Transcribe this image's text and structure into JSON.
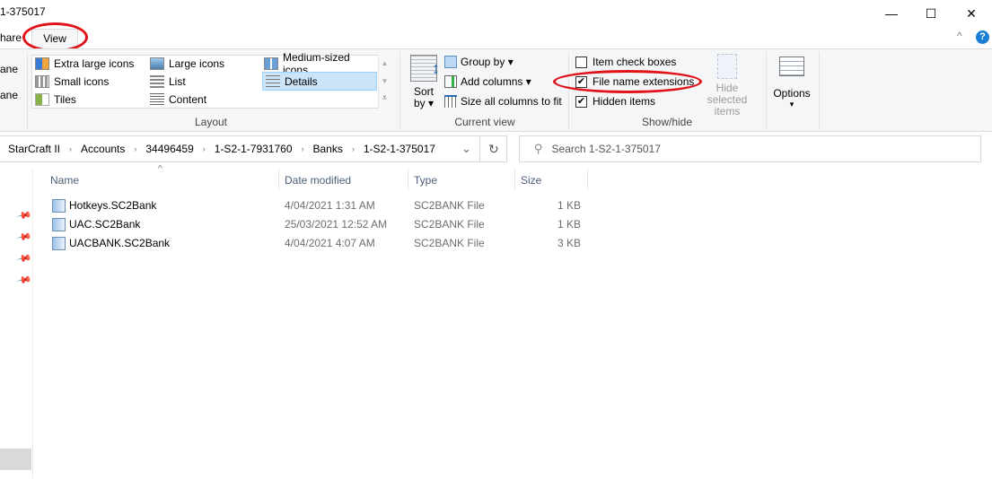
{
  "window": {
    "title": "1-375017",
    "controls": {
      "minimize": "—",
      "maximize": "☐",
      "close": "✕"
    }
  },
  "tabs": [
    {
      "label": "hare",
      "active": false
    },
    {
      "label": "View",
      "active": true
    }
  ],
  "ribbon": {
    "collapse_label": "^",
    "help_label": "?",
    "panes_partial": [
      "ane",
      "ane"
    ],
    "layout": {
      "group_label": "Layout",
      "items": [
        {
          "label": "Extra large icons",
          "icon": "extra-large-icons-icon"
        },
        {
          "label": "Large icons",
          "icon": "large-icons-icon"
        },
        {
          "label": "Medium-sized icons",
          "icon": "medium-icons-icon"
        },
        {
          "label": "Small icons",
          "icon": "small-icons-icon"
        },
        {
          "label": "List",
          "icon": "list-icon"
        },
        {
          "label": "Details",
          "icon": "details-icon",
          "selected": true
        },
        {
          "label": "Tiles",
          "icon": "tiles-icon"
        },
        {
          "label": "Content",
          "icon": "content-icon"
        }
      ],
      "scroll": {
        "up": "▲",
        "down": "▼",
        "more": "⩡"
      }
    },
    "current_view": {
      "group_label": "Current view",
      "sort_by_line1": "Sort",
      "sort_by_line2": "by ▾",
      "group_by": "Group by ▾",
      "add_columns": "Add columns ▾",
      "size_columns": "Size all columns to fit"
    },
    "show_hide": {
      "group_label": "Show/hide",
      "item_check_boxes": {
        "label": "Item check boxes",
        "checked": false
      },
      "file_name_extensions": {
        "label": "File name extensions",
        "checked": true
      },
      "hidden_items": {
        "label": "Hidden items",
        "checked": true
      },
      "hide_selected_line1": "Hide selected",
      "hide_selected_line2": "items",
      "check_mark": "✔"
    },
    "options": {
      "label": "Options",
      "arrow": "▾"
    }
  },
  "address_bar": {
    "breadcrumbs": [
      "StarCraft II",
      "Accounts",
      "34496459",
      "1-S2-1-7931760",
      "Banks",
      "1-S2-1-375017"
    ],
    "separator": "›",
    "dropdown": "⌄",
    "refresh": "↻"
  },
  "search": {
    "placeholder": "Search 1-S2-1-375017",
    "icon": "⚲"
  },
  "columns": {
    "name": "Name",
    "date": "Date modified",
    "type": "Type",
    "size": "Size",
    "sort_indicator": "^"
  },
  "files": [
    {
      "name": "Hotkeys.SC2Bank",
      "date": "4/04/2021 1:31 AM",
      "type": "SC2BANK File",
      "size": "1 KB"
    },
    {
      "name": "UAC.SC2Bank",
      "date": "25/03/2021 12:52 AM",
      "type": "SC2BANK File",
      "size": "1 KB"
    },
    {
      "name": "UACBANK.SC2Bank",
      "date": "4/04/2021 4:07 AM",
      "type": "SC2BANK File",
      "size": "3 KB"
    }
  ],
  "nav_pins": [
    "📌",
    "📌",
    "📌",
    "📌"
  ],
  "accent": {
    "annotation_red": "#e0131a",
    "selection_blue": "#cce4f7",
    "help_blue": "#1a7fd6"
  }
}
